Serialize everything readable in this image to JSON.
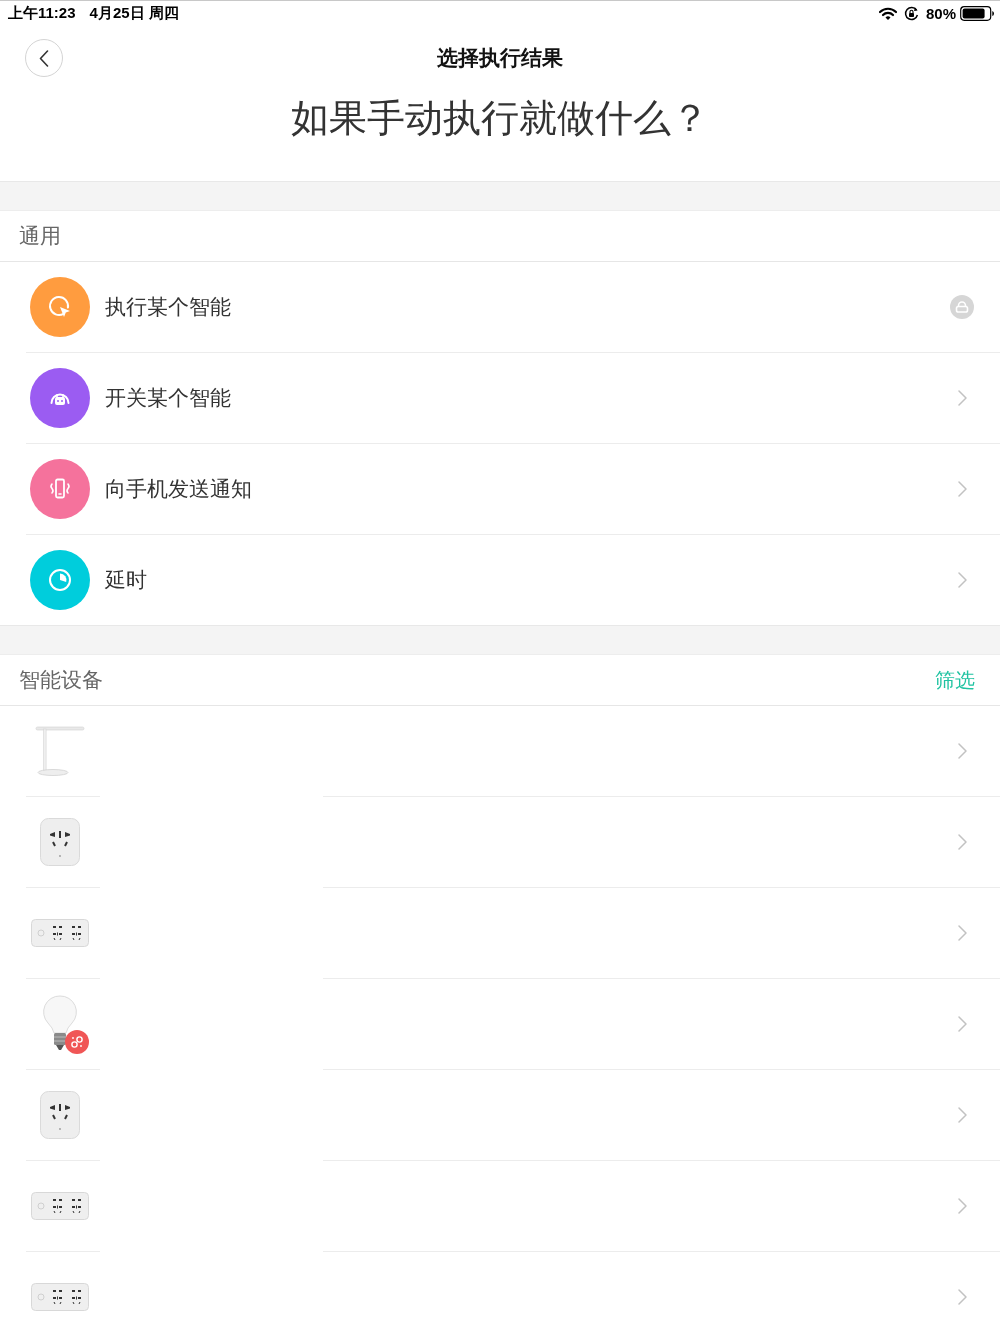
{
  "status_bar": {
    "time": "上午11:23",
    "date": "4月25日 周四",
    "battery": "80%"
  },
  "header": {
    "title": "选择执行结果",
    "question": "如果手动执行就做什么？"
  },
  "general": {
    "title": "通用",
    "items": [
      {
        "kind": "run",
        "label": "执行某个智能",
        "color": "#ff9c3f",
        "locked": true
      },
      {
        "kind": "toggle",
        "label": "开关某个智能",
        "color": "#9b5cf2",
        "locked": false
      },
      {
        "kind": "notify",
        "label": "向手机发送通知",
        "color": "#f5729c",
        "locked": false
      },
      {
        "kind": "delay",
        "label": "延时",
        "color": "#00cddc",
        "locked": false
      }
    ]
  },
  "devices": {
    "title": "智能设备",
    "filter": "筛选",
    "items": [
      {
        "kind": "lamp",
        "badge": false
      },
      {
        "kind": "plug",
        "badge": false
      },
      {
        "kind": "strip",
        "badge": false
      },
      {
        "kind": "bulb",
        "badge": true
      },
      {
        "kind": "plug",
        "badge": false
      },
      {
        "kind": "strip",
        "badge": false
      },
      {
        "kind": "strip",
        "badge": false
      }
    ]
  }
}
